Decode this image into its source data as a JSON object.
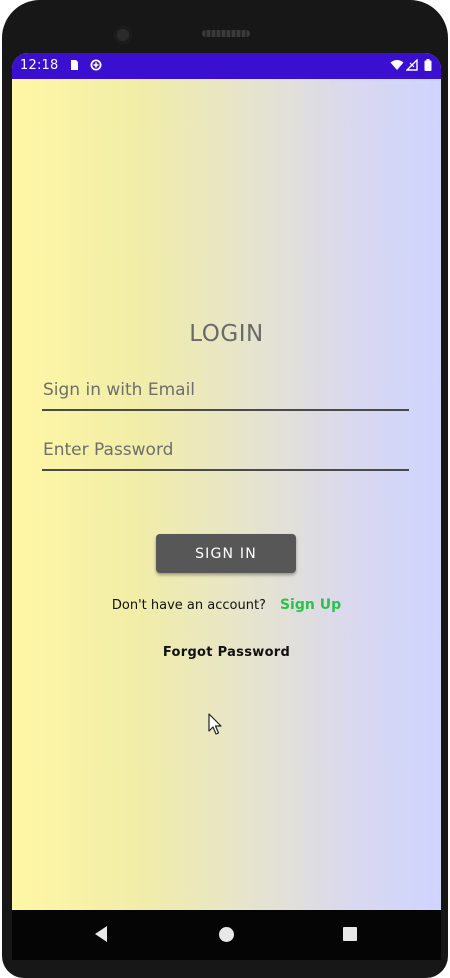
{
  "status_bar": {
    "time": "12:18",
    "background": "#3b0fcf"
  },
  "login": {
    "title": "LOGIN",
    "email_placeholder": "Sign in with Email",
    "email_value": "",
    "password_placeholder": "Enter Password",
    "password_value": "",
    "sign_in_label": "SIGN IN",
    "no_account_text": "Don't have an account?",
    "sign_up_label": "Sign Up",
    "forgot_password_label": "Forgot Password"
  },
  "colors": {
    "accent_green": "#2bc24c",
    "button_gray": "#575757",
    "gradient_left": "#fff7a5",
    "gradient_right": "#cfd4ff"
  },
  "icons": {
    "status_left": [
      "sim-card-icon",
      "data-saver-icon"
    ],
    "status_right": [
      "wifi-icon",
      "signal-icon",
      "battery-icon"
    ],
    "navigation": [
      "back-icon",
      "home-icon",
      "recents-icon"
    ],
    "pointer": "mouse-cursor-icon"
  }
}
